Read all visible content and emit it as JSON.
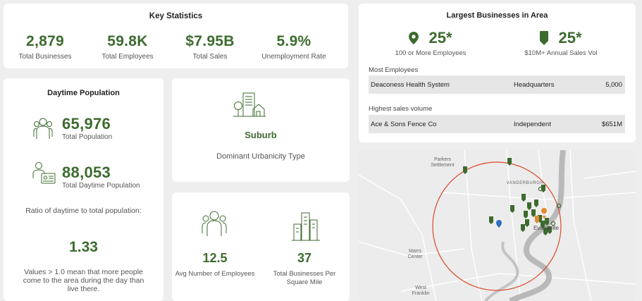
{
  "key_statistics": {
    "title": "Key Statistics",
    "stats": [
      {
        "value": "2,879",
        "label": "Total Businesses"
      },
      {
        "value": "59.8K",
        "label": "Total Employees"
      },
      {
        "value": "$7.95B",
        "label": "Total Sales"
      },
      {
        "value": "5.9%",
        "label": "Unemployment Rate"
      }
    ]
  },
  "largest_businesses": {
    "title": "Largest Businesses in Area",
    "employees_stat": {
      "value": "25*",
      "label": "100 or More Employees",
      "icon": "map-pin-icon"
    },
    "sales_stat": {
      "value": "25*",
      "label": "$10M+ Annual Sales Vol",
      "icon": "marker-icon"
    },
    "most_employees": {
      "label": "Most Employees",
      "name": "Deaconess Health System",
      "type": "Headquarters",
      "value": "5,000"
    },
    "highest_sales": {
      "label": "Highest sales volume",
      "name": "Ace & Sons Fence Co",
      "type": "Independent",
      "value": "$651M"
    }
  },
  "daytime_population": {
    "title": "Daytime Population",
    "total_population": {
      "value": "65,976",
      "label": "Total Population"
    },
    "daytime_population": {
      "value": "88,053",
      "label": "Total Daytime Population"
    },
    "ratio_label": "Ratio of daytime to total population:",
    "ratio_value": "1.33",
    "ratio_note": "Values > 1.0 mean that more people come to the area during the day than live there."
  },
  "urbanicity": {
    "type": "Suburb",
    "label": "Dominant Urbanicity Type"
  },
  "employees": {
    "avg": {
      "value": "12.5",
      "label": "Avg Number of Employees"
    },
    "density": {
      "value": "37",
      "label": "Total Businesses Per Square Mile"
    }
  },
  "map": {
    "labels": {
      "parkers": "Parkers Settlement",
      "vanderburgh": "VANDERBURGH",
      "evansville": "Evansville",
      "marrs": "Marrs Center",
      "west_franklin": "West Franklin"
    },
    "colors": {
      "buffer": "#d94a2a",
      "marker": "#3d6b2f",
      "highlight": "#e28a2b",
      "selected": "#2d6ec4"
    }
  },
  "colors": {
    "accent": "#3d6b2f",
    "background": "#eeeeee",
    "card": "#ffffff",
    "row": "#e6e6e6"
  }
}
